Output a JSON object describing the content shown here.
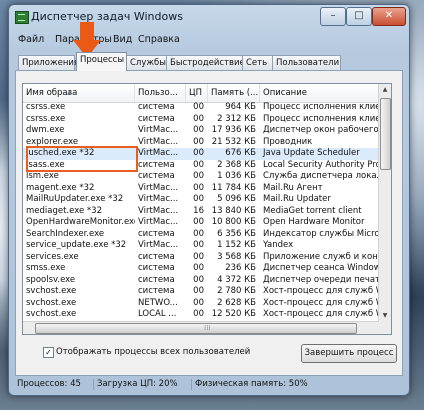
{
  "window": {
    "title": "Диспетчер задач Windows",
    "controls": {
      "minimize": "–",
      "maximize": "□",
      "close": "✕"
    }
  },
  "menu": [
    "Файл",
    "Параметры",
    "Вид",
    "Справка"
  ],
  "tabs": [
    "Приложения",
    "Процессы",
    "Службы",
    "Быстродействие",
    "Сеть",
    "Пользователи"
  ],
  "active_tab": "Процессы",
  "columns": [
    "Имя образа",
    "Пользо...",
    "ЦП",
    "Память (...",
    "Описание"
  ],
  "processes": [
    {
      "name": "csrss.exe",
      "user": "система",
      "cpu": "00",
      "mem": "964 КБ",
      "desc": "Процесс исполнения клие"
    },
    {
      "name": "csrss.exe",
      "user": "система",
      "cpu": "00",
      "mem": "2 312 КБ",
      "desc": "Процесс исполнения клие"
    },
    {
      "name": "dwm.exe",
      "user": "VirtMac...",
      "cpu": "00",
      "mem": "17 936 КБ",
      "desc": "Диспетчер окон рабочего"
    },
    {
      "name": "explorer.exe",
      "user": "VirtMac...",
      "cpu": "00",
      "mem": "21 532 КБ",
      "desc": "Проводник"
    },
    {
      "name": "jusched.exe *32",
      "user": "VirtMac...",
      "cpu": "00",
      "mem": "676 КБ",
      "desc": "Java Update Scheduler"
    },
    {
      "name": "lsass.exe",
      "user": "система",
      "cpu": "00",
      "mem": "2 368 КБ",
      "desc": "Local Security Authority Pro"
    },
    {
      "name": "lsm.exe",
      "user": "система",
      "cpu": "00",
      "mem": "1 036 КБ",
      "desc": "Служба диспетчера локал"
    },
    {
      "name": "magent.exe *32",
      "user": "VirtMac...",
      "cpu": "00",
      "mem": "11 784 КБ",
      "desc": "Mail.Ru Агент"
    },
    {
      "name": "MailRuUpdater.exe *32",
      "user": "VirtMac...",
      "cpu": "00",
      "mem": "5 096 КБ",
      "desc": "Mail.Ru Updater"
    },
    {
      "name": "mediaget.exe *32",
      "user": "VirtMac...",
      "cpu": "16",
      "mem": "13 840 КБ",
      "desc": "MediaGet torrent client"
    },
    {
      "name": "OpenHardwareMonitor.exe",
      "user": "VirtMac...",
      "cpu": "00",
      "mem": "10 800 КБ",
      "desc": "Open Hardware Monitor"
    },
    {
      "name": "SearchIndexer.exe",
      "user": "система",
      "cpu": "00",
      "mem": "6 356 КБ",
      "desc": "Индексатор службы Micros"
    },
    {
      "name": "service_update.exe *32",
      "user": "VirtMac...",
      "cpu": "00",
      "mem": "1 152 КБ",
      "desc": "Yandex"
    },
    {
      "name": "services.exe",
      "user": "система",
      "cpu": "00",
      "mem": "3 568 КБ",
      "desc": "Приложение служб и контр"
    },
    {
      "name": "smss.exe",
      "user": "система",
      "cpu": "00",
      "mem": "236 КБ",
      "desc": "Диспетчер сеанса Window"
    },
    {
      "name": "spoolsv.exe",
      "user": "система",
      "cpu": "00",
      "mem": "4 372 КБ",
      "desc": "Диспетчер очереди печат"
    },
    {
      "name": "svchost.exe",
      "user": "система",
      "cpu": "00",
      "mem": "2 780 КБ",
      "desc": "Хост-процесс для служб W"
    },
    {
      "name": "svchost.exe",
      "user": "NETWO...",
      "cpu": "00",
      "mem": "2 628 КБ",
      "desc": "Хост-процесс для служб W"
    },
    {
      "name": "svchost.exe",
      "user": "LOCAL ...",
      "cpu": "00",
      "mem": "12 520 КБ",
      "desc": "Хост-процесс для служб W"
    }
  ],
  "selected_process": "jusched.exe *32",
  "show_all_users": {
    "label": "Отображать процессы всех пользователей",
    "checked": "✓"
  },
  "end_process_button": "Завершить процесс",
  "status": {
    "processes": "Процессов: 45",
    "cpu": "Загрузка ЦП: 20%",
    "memory": "Физическая память: 50%"
  }
}
